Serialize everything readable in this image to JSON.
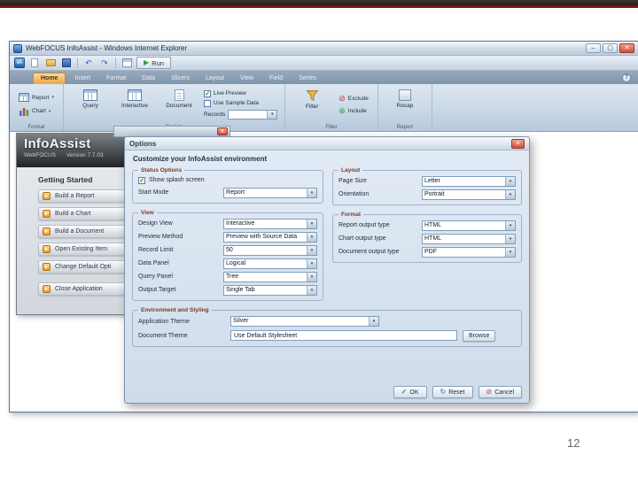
{
  "slide": {
    "page_number": "12"
  },
  "window": {
    "title": "WebFOCUS InfoAssist - Windows Internet Explorer"
  },
  "icons": {
    "minimize": "–",
    "maximize": "▢",
    "close": "✕",
    "dropdown": "▾",
    "check": "✓",
    "run_play": "▶",
    "undo": "↶",
    "redo": "↷",
    "help": "?",
    "item_arrow": "▸",
    "ok_check": "✓",
    "reset": "↻",
    "cancel": "⊘",
    "exclude": "⊘",
    "include": "⊕"
  },
  "toolbar": {
    "logo_text": "IA",
    "run_label": "Run"
  },
  "ribbon": {
    "tabs": [
      {
        "label": "Home"
      },
      {
        "label": "Insert"
      },
      {
        "label": "Format"
      },
      {
        "label": "Data"
      },
      {
        "label": "Slicers"
      },
      {
        "label": "Layout"
      },
      {
        "label": "View"
      },
      {
        "label": "Field"
      },
      {
        "label": "Series"
      }
    ],
    "groups": {
      "format": {
        "label": "Format",
        "report": "Report",
        "chart": "Chart"
      },
      "design": {
        "label": "Design",
        "query": "Query",
        "interactive": "Interactive",
        "document": "Document",
        "live_preview": "Live Preview",
        "use_sample_data": "Use Sample Data",
        "records": "Records",
        "records_value": ""
      },
      "filter": {
        "label": "Filter",
        "filter_button": "Filter",
        "exclude": "Exclude",
        "include": "Include"
      },
      "report": {
        "label": "Report",
        "recap": "Recap"
      }
    }
  },
  "sidebar": {
    "app_name": "InfoAssist",
    "vendor": "WebFOCUS",
    "version": "Version 7.7.03",
    "section_title": "Getting Started",
    "items": [
      {
        "label": "Build a Report"
      },
      {
        "label": "Build a Chart"
      },
      {
        "label": "Build a Document"
      },
      {
        "label": "Open Existing Item"
      },
      {
        "label": "Change Default Opti"
      },
      {
        "label": "Close Application"
      }
    ]
  },
  "dialog": {
    "title": "Options",
    "header": "Customize your InfoAssist environment",
    "status_options": {
      "legend": "Status Options",
      "show_splash_label": "Show splash screen",
      "start_mode": {
        "label": "Start Mode",
        "value": "Report"
      }
    },
    "view": {
      "legend": "View",
      "fields": [
        {
          "label": "Design View",
          "value": "Interactive"
        },
        {
          "label": "Preview Method",
          "value": "Preview with Source Data"
        },
        {
          "label": "Record Limit",
          "value": "50"
        },
        {
          "label": "Data Panel",
          "value": "Logical"
        },
        {
          "label": "Query Panel",
          "value": "Tree"
        },
        {
          "label": "Output Target",
          "value": "Single Tab"
        }
      ]
    },
    "layout": {
      "legend": "Layout",
      "fields": [
        {
          "label": "Page Size",
          "value": "Letter"
        },
        {
          "label": "Orientation",
          "value": "Portrait"
        }
      ]
    },
    "format": {
      "legend": "Format",
      "fields": [
        {
          "label": "Report output type",
          "value": "HTML"
        },
        {
          "label": "Chart output type",
          "value": "HTML"
        },
        {
          "label": "Document output type",
          "value": "PDF"
        }
      ]
    },
    "environment": {
      "legend": "Environment and Styling",
      "application_theme": {
        "label": "Application Theme",
        "value": "Silver"
      },
      "document_theme": {
        "label": "Document Theme",
        "value": "Use Default Stylesheet"
      },
      "browse_label": "Browse"
    },
    "buttons": {
      "ok": "OK",
      "reset": "Reset",
      "cancel": "Cancel"
    }
  }
}
